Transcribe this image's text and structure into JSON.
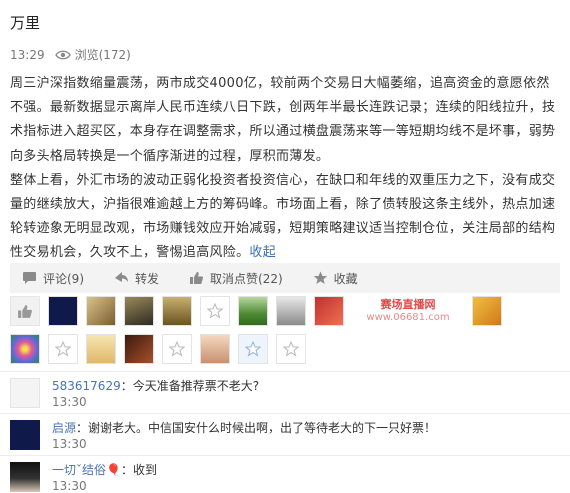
{
  "post": {
    "author": "万里",
    "time": "13:29",
    "views": "浏览(172)",
    "paragraphs": [
      "周三沪深指数缩量震荡，两市成交4000亿，较前两个交易日大幅萎缩，追高资金的意愿依然不强。最新数据显示离岸人民币连续八日下跌，创两年半最长连跌记录；连续的阳线拉升，技术指标进入超买区，本身存在调整需求，所以通过横盘震荡来等一等短期均线不是坏事，弱势向多头格局转换是一个循序渐进的过程，厚积而薄发。",
      "整体上看，外汇市场的波动正弱化投资者投资信心，在缺口和年线的双重压力之下，没有成交量的继续放大，沪指很难逾越上方的筹码峰。市场面上看，除了债转股这条主线外，热点加速轮转迹象无明显改观，市场赚钱效应开始减弱，短期策略建议适当控制仓位，关注局部的结构性交易机会，久攻不上，警惕追高风险。"
    ],
    "collapse": "收起"
  },
  "actions": {
    "comment": "评论(9)",
    "repost": "转发",
    "unlike": "取消点赞(22)",
    "favorite": "收藏"
  },
  "likers_watermark": {
    "line1": "赛场直播网",
    "line2": "www.06681.com"
  },
  "comments": [
    {
      "user": "583617629",
      "text": "：今天准备推荐票不老大?",
      "time": "13:30"
    },
    {
      "user": "启源",
      "text": "：谢谢老大。中信国安什么时候出啊，出了等待老大的下一只好票！",
      "time": "13:30"
    },
    {
      "user": "一切ˇ结俗🎈",
      "text": "：收到",
      "time": "13:30"
    }
  ],
  "colors": {
    "link": "#4a74b4",
    "action_bar": "#f3f3f3"
  }
}
